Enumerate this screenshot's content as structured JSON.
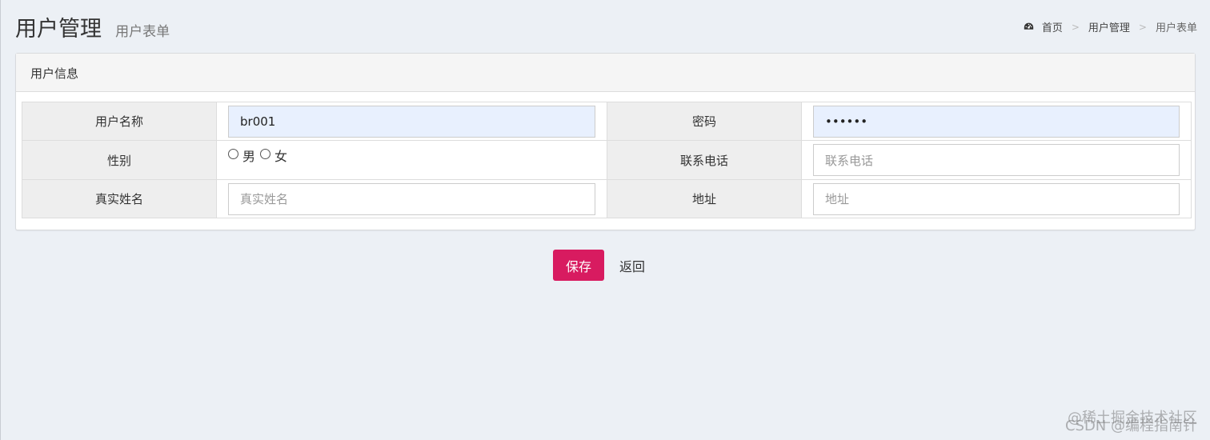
{
  "header": {
    "title": "用户管理",
    "subtitle": "用户表单"
  },
  "breadcrumb": {
    "icon": "dashboard-icon",
    "items": [
      "首页",
      "用户管理",
      "用户表单"
    ],
    "separator": ">"
  },
  "box": {
    "title": "用户信息"
  },
  "form": {
    "username": {
      "label": "用户名称",
      "value": "br001"
    },
    "password": {
      "label": "密码",
      "value": "••••••"
    },
    "gender": {
      "label": "性别",
      "options": [
        "男",
        "女"
      ]
    },
    "phone": {
      "label": "联系电话",
      "placeholder": "联系电话"
    },
    "realname": {
      "label": "真实姓名",
      "placeholder": "真实姓名"
    },
    "address": {
      "label": "地址",
      "placeholder": "地址"
    }
  },
  "buttons": {
    "save": "保存",
    "back": "返回"
  },
  "watermark": {
    "line1": "@稀土掘金技术社区",
    "line2": "CSDN @编程指南针"
  },
  "colors": {
    "background": "#ecf0f5",
    "primary_button": "#d81b60",
    "autofill": "#e8f0fe"
  }
}
